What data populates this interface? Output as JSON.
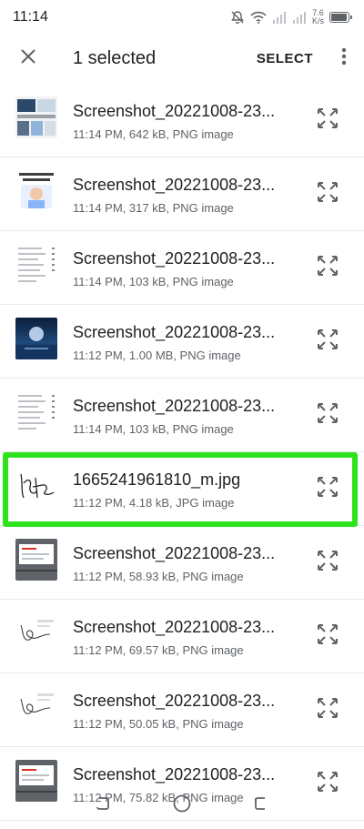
{
  "status_bar": {
    "time": "11:14",
    "net_speed_value": "7.6",
    "net_speed_unit": "K/s",
    "battery_level": 0.85
  },
  "app_bar": {
    "title": "1 selected",
    "select_label": "SELECT",
    "close_icon": "close-icon",
    "more_icon": "more-vert-icon"
  },
  "files": [
    {
      "name": "Screenshot_20221008-23...",
      "meta": "11:14 PM, 642 kB, PNG image",
      "thumb": "screenshot-thumb"
    },
    {
      "name": "Screenshot_20221008-23...",
      "meta": "11:14 PM, 317 kB, PNG image",
      "thumb": "background-thumb"
    },
    {
      "name": "Screenshot_20221008-23...",
      "meta": "11:14 PM, 103 kB, PNG image",
      "thumb": "list-thumb"
    },
    {
      "name": "Screenshot_20221008-23...",
      "meta": "11:12 PM, 1.00 MB, PNG image",
      "thumb": "night-sky-thumb"
    },
    {
      "name": "Screenshot_20221008-23...",
      "meta": "11:14 PM, 103 kB, PNG image",
      "thumb": "list-thumb"
    },
    {
      "name": "1665241961810_m.jpg",
      "meta": "11:12 PM, 4.18 kB, JPG image",
      "thumb": "signature-thumb",
      "selected": true
    },
    {
      "name": "Screenshot_20221008-23...",
      "meta": "11:12 PM, 58.93 kB, PNG image",
      "thumb": "dialog-thumb"
    },
    {
      "name": "Screenshot_20221008-23...",
      "meta": "11:12 PM, 69.57 kB, PNG image",
      "thumb": "signature-screenshot-thumb"
    },
    {
      "name": "Screenshot_20221008-23...",
      "meta": "11:12 PM, 50.05 kB, PNG image",
      "thumb": "signature-screenshot-thumb"
    },
    {
      "name": "Screenshot_20221008-23...",
      "meta": "11:12 PM, 75.82 kB, PNG image",
      "thumb": "dialog-thumb"
    }
  ],
  "colors": {
    "highlight": "#2ee31d",
    "text_primary": "#202124",
    "text_secondary": "#5f6368"
  }
}
